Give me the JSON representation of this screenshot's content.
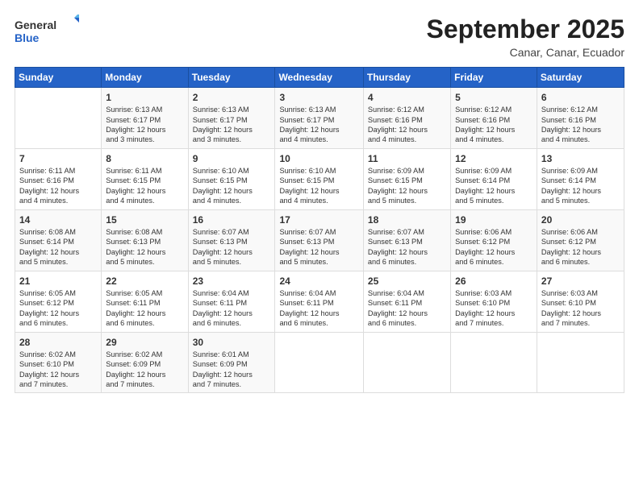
{
  "header": {
    "logo": {
      "general": "General",
      "blue": "Blue"
    },
    "title": "September 2025",
    "location": "Canar, Canar, Ecuador"
  },
  "calendar": {
    "days_of_week": [
      "Sunday",
      "Monday",
      "Tuesday",
      "Wednesday",
      "Thursday",
      "Friday",
      "Saturday"
    ],
    "weeks": [
      [
        {
          "day": "",
          "info": ""
        },
        {
          "day": "1",
          "info": "Sunrise: 6:13 AM\nSunset: 6:17 PM\nDaylight: 12 hours\nand 3 minutes."
        },
        {
          "day": "2",
          "info": "Sunrise: 6:13 AM\nSunset: 6:17 PM\nDaylight: 12 hours\nand 3 minutes."
        },
        {
          "day": "3",
          "info": "Sunrise: 6:13 AM\nSunset: 6:17 PM\nDaylight: 12 hours\nand 4 minutes."
        },
        {
          "day": "4",
          "info": "Sunrise: 6:12 AM\nSunset: 6:16 PM\nDaylight: 12 hours\nand 4 minutes."
        },
        {
          "day": "5",
          "info": "Sunrise: 6:12 AM\nSunset: 6:16 PM\nDaylight: 12 hours\nand 4 minutes."
        },
        {
          "day": "6",
          "info": "Sunrise: 6:12 AM\nSunset: 6:16 PM\nDaylight: 12 hours\nand 4 minutes."
        }
      ],
      [
        {
          "day": "7",
          "info": "Sunrise: 6:11 AM\nSunset: 6:16 PM\nDaylight: 12 hours\nand 4 minutes."
        },
        {
          "day": "8",
          "info": "Sunrise: 6:11 AM\nSunset: 6:15 PM\nDaylight: 12 hours\nand 4 minutes."
        },
        {
          "day": "9",
          "info": "Sunrise: 6:10 AM\nSunset: 6:15 PM\nDaylight: 12 hours\nand 4 minutes."
        },
        {
          "day": "10",
          "info": "Sunrise: 6:10 AM\nSunset: 6:15 PM\nDaylight: 12 hours\nand 4 minutes."
        },
        {
          "day": "11",
          "info": "Sunrise: 6:09 AM\nSunset: 6:15 PM\nDaylight: 12 hours\nand 5 minutes."
        },
        {
          "day": "12",
          "info": "Sunrise: 6:09 AM\nSunset: 6:14 PM\nDaylight: 12 hours\nand 5 minutes."
        },
        {
          "day": "13",
          "info": "Sunrise: 6:09 AM\nSunset: 6:14 PM\nDaylight: 12 hours\nand 5 minutes."
        }
      ],
      [
        {
          "day": "14",
          "info": "Sunrise: 6:08 AM\nSunset: 6:14 PM\nDaylight: 12 hours\nand 5 minutes."
        },
        {
          "day": "15",
          "info": "Sunrise: 6:08 AM\nSunset: 6:13 PM\nDaylight: 12 hours\nand 5 minutes."
        },
        {
          "day": "16",
          "info": "Sunrise: 6:07 AM\nSunset: 6:13 PM\nDaylight: 12 hours\nand 5 minutes."
        },
        {
          "day": "17",
          "info": "Sunrise: 6:07 AM\nSunset: 6:13 PM\nDaylight: 12 hours\nand 5 minutes."
        },
        {
          "day": "18",
          "info": "Sunrise: 6:07 AM\nSunset: 6:13 PM\nDaylight: 12 hours\nand 6 minutes."
        },
        {
          "day": "19",
          "info": "Sunrise: 6:06 AM\nSunset: 6:12 PM\nDaylight: 12 hours\nand 6 minutes."
        },
        {
          "day": "20",
          "info": "Sunrise: 6:06 AM\nSunset: 6:12 PM\nDaylight: 12 hours\nand 6 minutes."
        }
      ],
      [
        {
          "day": "21",
          "info": "Sunrise: 6:05 AM\nSunset: 6:12 PM\nDaylight: 12 hours\nand 6 minutes."
        },
        {
          "day": "22",
          "info": "Sunrise: 6:05 AM\nSunset: 6:11 PM\nDaylight: 12 hours\nand 6 minutes."
        },
        {
          "day": "23",
          "info": "Sunrise: 6:04 AM\nSunset: 6:11 PM\nDaylight: 12 hours\nand 6 minutes."
        },
        {
          "day": "24",
          "info": "Sunrise: 6:04 AM\nSunset: 6:11 PM\nDaylight: 12 hours\nand 6 minutes."
        },
        {
          "day": "25",
          "info": "Sunrise: 6:04 AM\nSunset: 6:11 PM\nDaylight: 12 hours\nand 6 minutes."
        },
        {
          "day": "26",
          "info": "Sunrise: 6:03 AM\nSunset: 6:10 PM\nDaylight: 12 hours\nand 7 minutes."
        },
        {
          "day": "27",
          "info": "Sunrise: 6:03 AM\nSunset: 6:10 PM\nDaylight: 12 hours\nand 7 minutes."
        }
      ],
      [
        {
          "day": "28",
          "info": "Sunrise: 6:02 AM\nSunset: 6:10 PM\nDaylight: 12 hours\nand 7 minutes."
        },
        {
          "day": "29",
          "info": "Sunrise: 6:02 AM\nSunset: 6:09 PM\nDaylight: 12 hours\nand 7 minutes."
        },
        {
          "day": "30",
          "info": "Sunrise: 6:01 AM\nSunset: 6:09 PM\nDaylight: 12 hours\nand 7 minutes."
        },
        {
          "day": "",
          "info": ""
        },
        {
          "day": "",
          "info": ""
        },
        {
          "day": "",
          "info": ""
        },
        {
          "day": "",
          "info": ""
        }
      ]
    ]
  }
}
